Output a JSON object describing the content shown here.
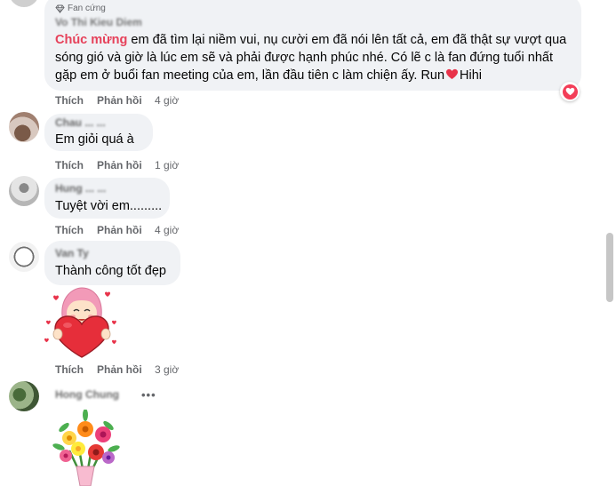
{
  "comments": [
    {
      "badge": "Fan cứng",
      "author": "Vo Thi Kieu Diem",
      "highlight": "Chúc mừng",
      "text": " em đã tìm lại niềm vui, nụ cười em đã nói lên tất cả, em đã thật sự vượt qua sóng gió và giờ là lúc em sẽ và phải được hạnh phúc nhé. Có lẽ c là fan đứng tuổi nhất gặp em ở buổi fan meeting của em, lần đầu tiên c làm chiện ấy. Run",
      "text_end": "Hihi",
      "like": "Thích",
      "reply": "Phản hồi",
      "time": "4 giờ"
    },
    {
      "author": "Chau ... ...",
      "text": "Em giỏi quá à",
      "like": "Thích",
      "reply": "Phản hồi",
      "time": "1 giờ"
    },
    {
      "author": "Hung ... ...",
      "text": "Tuyệt vời em.........",
      "like": "Thích",
      "reply": "Phản hồi",
      "time": "4 giờ"
    },
    {
      "author": "Van Ty",
      "text": "Thành công tốt đẹp",
      "like": "Thích",
      "reply": "Phản hồi",
      "time": "3 giờ"
    },
    {
      "author": "Hong Chung",
      "more": "•••"
    }
  ],
  "icons": {
    "badge": "diamond-icon",
    "heart": "heart-icon",
    "reaction": "love-reaction-icon",
    "sticker1": "heart-girl-sticker",
    "sticker2": "flower-bouquet-sticker"
  },
  "colors": {
    "highlight": "#e6415a",
    "bubble": "#f0f2f5",
    "meta": "#65676b",
    "heart": "#e8334a"
  }
}
